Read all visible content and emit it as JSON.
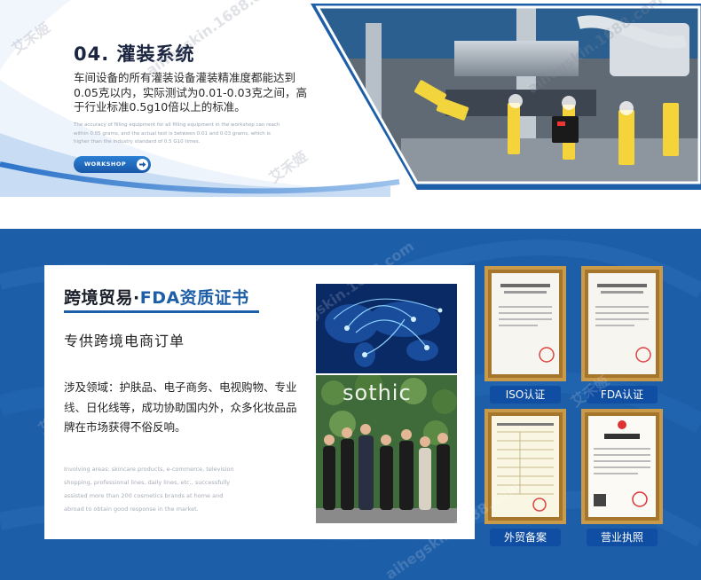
{
  "workshop_section": {
    "title": "04. 灌装系统",
    "description": "车间设备的所有灌装设备灌装精准度都能达到0.05克以内，实际测试为0.01-0.03克之间，高于行业标准0.5g10倍以上的标准。",
    "description_en": "The accuracy of filling equipment for all filling equipment in the workshop can reach within 0.05 grams, and the actual test is between 0.01 and 0.03 grams, which is higher than the industry standard of 0.5 G10 times.",
    "button_label": "WORKSHOP"
  },
  "trade_section": {
    "title_main": "跨境贸易·",
    "title_highlight": "FDA资质证书",
    "subtitle": "专供跨境电商订单",
    "description": "涉及领域：护肤品、电子商务、电视购物、专业线、日化线等，成功协助国内外，众多化妆品品牌在市场获得不俗反响。",
    "description_en": "Involving areas: skincare products, e-commerce, television shopping, professional lines, daily lines, etc., successfully assisted more than 200 cosmetics brands at home and abroad to obtain good response in the market.",
    "team_sign": "sothic"
  },
  "certificates": [
    {
      "label": "ISO认证"
    },
    {
      "label": "FDA认证"
    },
    {
      "label": "外贸备案"
    },
    {
      "label": "营业执照"
    }
  ],
  "watermark": {
    "brand": "艾禾姬",
    "site": "aihegskin.1688.com"
  },
  "colors": {
    "brand_blue": "#1d5ea8",
    "label_blue": "#0f4ea2",
    "frame_gold": "#c89a4a"
  }
}
